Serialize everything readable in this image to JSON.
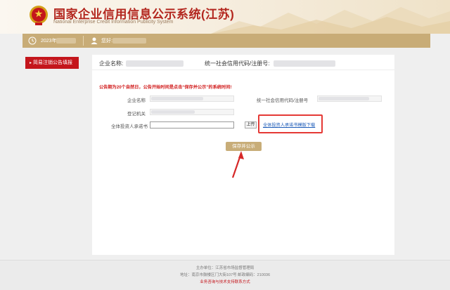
{
  "header": {
    "title": "国家企业信用信息公示系统(江苏)",
    "subtitle": "National Enterprise Credit Information Publicity System"
  },
  "infobar": {
    "date_prefix": "2023年",
    "user_prefix": "您好:"
  },
  "sidebar": {
    "items": [
      {
        "label": "简易注销公告填报"
      }
    ]
  },
  "main": {
    "company_name_label": "企业名称:",
    "credit_code_label": "统一社会信用代码/注册号:",
    "notice": "公告期为20个自然日，公告开始时间是点击“保存并公示”的系统时间!",
    "form": {
      "company_name_label": "企业名称",
      "credit_code_label": "统一社会信用代码/注册号",
      "registration_authority_label": "登记机关",
      "investor_commitment_label": "全体投资人承诺书",
      "upload_button": "上传",
      "download_link": "全体投资人承诺书模版下载",
      "save_button": "保存并公示"
    }
  },
  "footer": {
    "sponsor": "主办单位：江苏省市场监督管理局",
    "address": "地址：南京市鼓楼区门大街107号  邮政编码：210036",
    "contact": "业务咨询与技术支持联系方式"
  },
  "colors": {
    "brand_red": "#c4161c",
    "gold": "#c8ac77",
    "link_blue": "#1c5bb8"
  }
}
